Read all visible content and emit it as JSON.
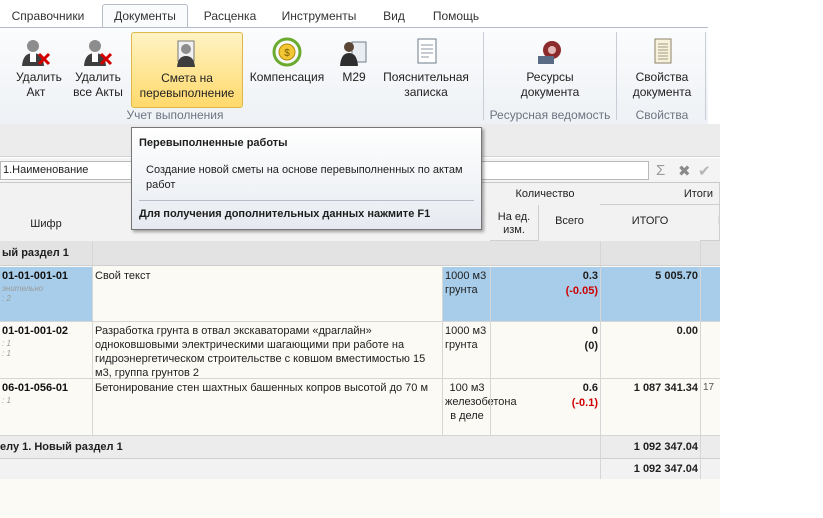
{
  "menu": {
    "tabs": [
      "Справочники",
      "Документы",
      "Расценка",
      "Инструменты",
      "Вид",
      "Помощь"
    ],
    "active": "Документы"
  },
  "ribbon": {
    "buttons": {
      "delete_act": "Удалить Акт",
      "delete_all_acts": "Удалить все Акты",
      "overrun_estimate": "Смета на перевыполнение",
      "compensation": "Компенсация",
      "m29": "М29",
      "explanatory_note": "Пояснительная записка",
      "doc_resources": "Ресурсы документа",
      "doc_properties": "Свойства документа"
    },
    "groups": {
      "acts": "Учет выполнения",
      "resources": "Ресурсная ведомость",
      "properties": "Свойства"
    }
  },
  "namebar": {
    "value": "1.Наименование"
  },
  "tooltip": {
    "title": "Перевыполненные работы",
    "description": "Создание новой сметы на основе перевыполненных по актам работ",
    "hint": "Для получения дополнительных данных нажмите F1"
  },
  "grid": {
    "headers": {
      "code": "Шифр",
      "quantity_group": "Количество",
      "per_unit": "На ед. изм.",
      "total": "Всего",
      "totals_group": "Итоги",
      "itogo": "ИТОГО",
      "it": "ИТ"
    },
    "section": "ый раздел 1",
    "rows": [
      {
        "code": "01-01-001-01",
        "sub1": "энительно",
        "sub2": ": 2",
        "name": "Свой текст",
        "unit": "1000 м3 грунта",
        "qty": "0.3",
        "diff": "(-0.05)",
        "itogo": "5 005.70",
        "it": ""
      },
      {
        "code": "01-01-001-02",
        "sub1": ": 1",
        "sub2": ": 1",
        "name": "Разработка грунта в отвал экскаваторами «драглайн» одноковшовыми электрическими шагающими при работе на гидроэнергетическом строительстве с ковшом вместимостью 15 м3, группа грунтов 2",
        "unit": "1000 м3 грунта",
        "qty": "0",
        "diff": "(0)",
        "itogo": "0.00",
        "it": ""
      },
      {
        "code": "06-01-056-01",
        "sub1": ": 1",
        "sub2": "",
        "name": "Бетонирование стен шахтных башенных копров высотой до 70 м",
        "unit": "100 м3 железобетона в деле",
        "qty": "0.6",
        "diff": "(-0.1)",
        "itogo": "1 087 341.34",
        "it": "17"
      }
    ],
    "section_total_label": "елу 1. Новый раздел 1",
    "section_total": "1 092 347.04",
    "grand_total": "1 092 347.04"
  },
  "colors": {
    "selected_row": "#a7cdea",
    "ribbon_highlight": "#ffd96b",
    "negative": "#d00000"
  }
}
